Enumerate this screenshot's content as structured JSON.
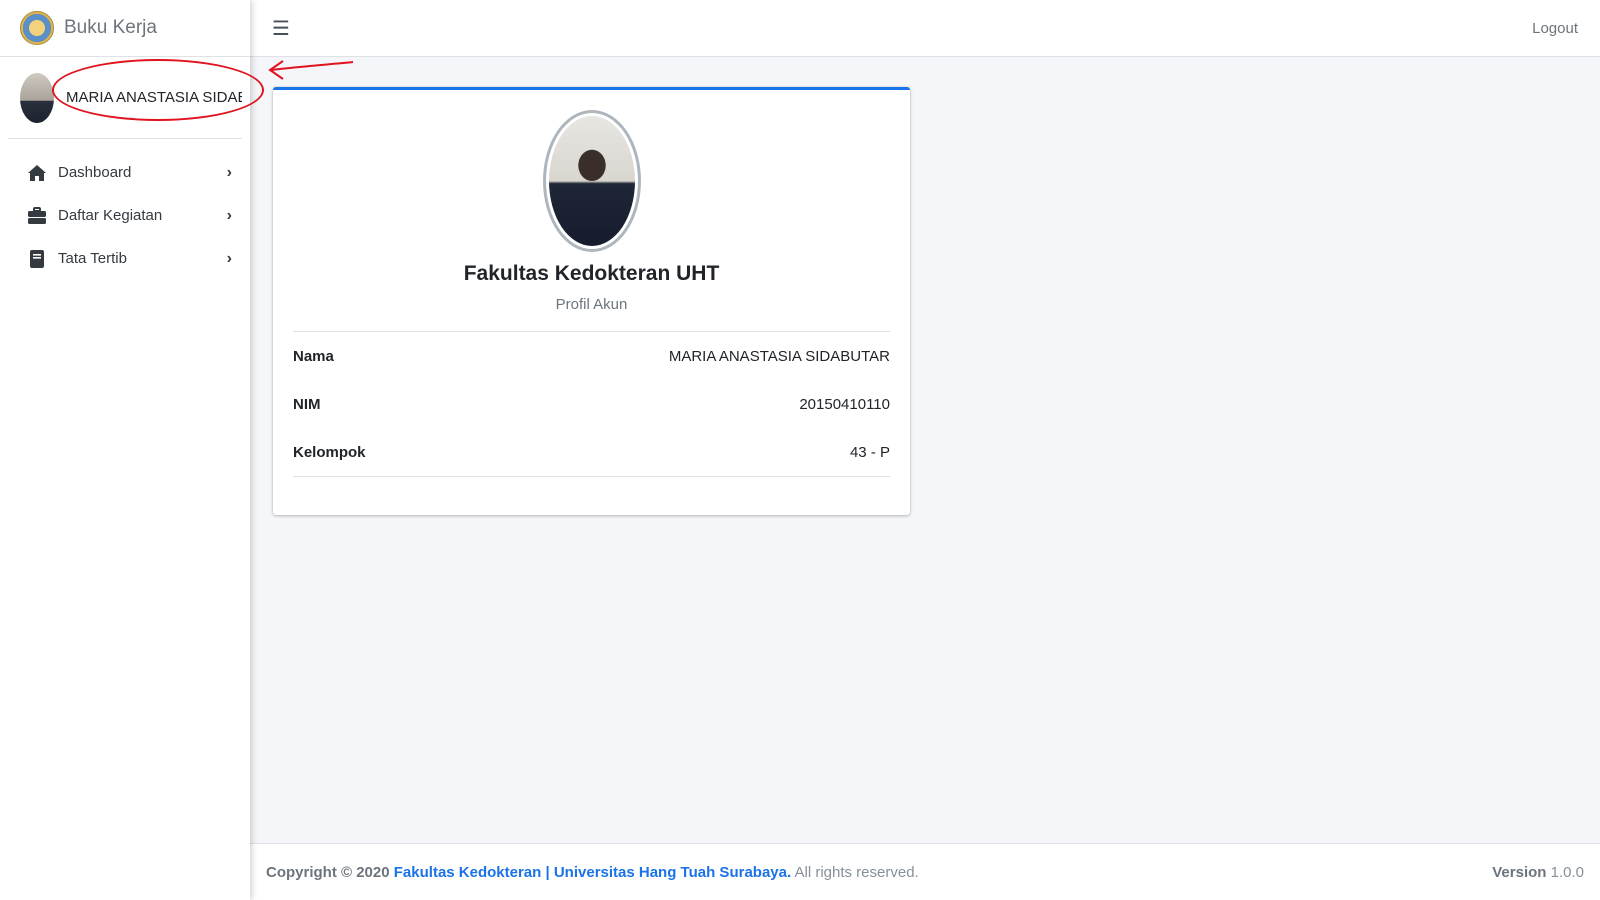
{
  "brand": {
    "title": "Buku Kerja"
  },
  "user": {
    "name": "MARIA ANASTASIA SIDABUTAR",
    "sidebar_name_visible": "MARIA ANASTASIA SIDAE"
  },
  "sidebar": {
    "items": [
      {
        "label": "Dashboard",
        "icon": "home-icon"
      },
      {
        "label": "Daftar Kegiatan",
        "icon": "briefcase-icon"
      },
      {
        "label": "Tata Tertib",
        "icon": "book-icon"
      }
    ]
  },
  "topbar": {
    "logout_label": "Logout"
  },
  "profile": {
    "title": "Fakultas Kedokteran UHT",
    "subtitle": "Profil Akun",
    "fields": [
      {
        "label": "Nama",
        "value": "MARIA ANASTASIA SIDABUTAR"
      },
      {
        "label": "NIM",
        "value": "20150410110"
      },
      {
        "label": "Kelompok",
        "value": "43 - P"
      }
    ]
  },
  "footer": {
    "copyright_prefix": "Copyright © 2020",
    "link_text": "Fakultas Kedokteran | Universitas Hang Tuah Surabaya.",
    "rights": "All rights reserved.",
    "version_label": "Version",
    "version_value": "1.0.0"
  },
  "colors": {
    "accent": "#1a73e8",
    "annotation": "#e0131f"
  }
}
